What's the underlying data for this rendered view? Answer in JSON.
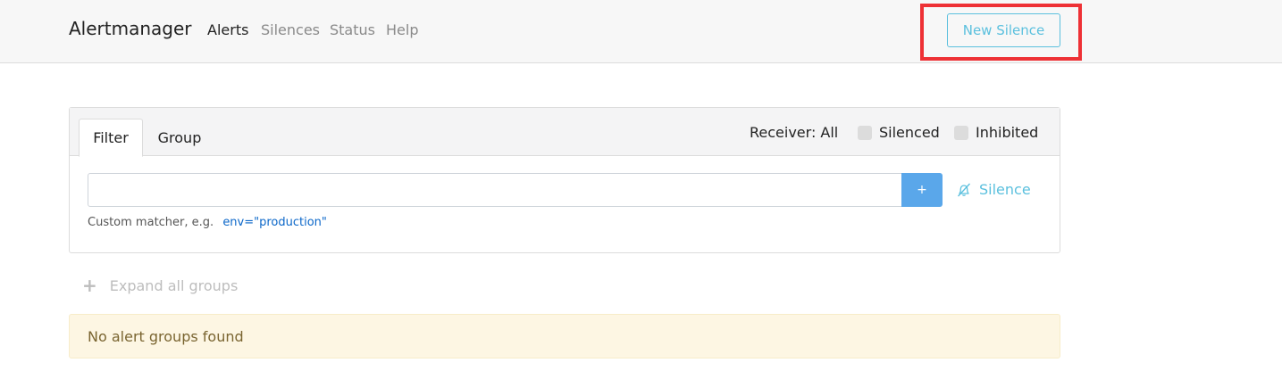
{
  "navbar": {
    "brand": "Alertmanager",
    "links": [
      "Alerts",
      "Silences",
      "Status",
      "Help"
    ],
    "active_link": "Alerts",
    "new_silence_label": "New Silence"
  },
  "filter_card": {
    "tabs": [
      "Filter",
      "Group"
    ],
    "active_tab": "Filter",
    "receiver_label": "Receiver: All",
    "silenced_label": "Silenced",
    "silenced_checked": false,
    "inhibited_label": "Inhibited",
    "inhibited_checked": false,
    "filter_input_value": "",
    "add_button_label": "+",
    "silence_link_label": "Silence",
    "help_text": "Custom matcher, e.g.",
    "help_example": "env=\"production\""
  },
  "expand_all_label": "Expand all groups",
  "empty_message": "No alert groups found",
  "colors": {
    "accent_info": "#5bc0de",
    "primary_button": "#5aa7ea",
    "highlight_border": "#ee3135",
    "warning_bg": "#fdf6e3"
  }
}
